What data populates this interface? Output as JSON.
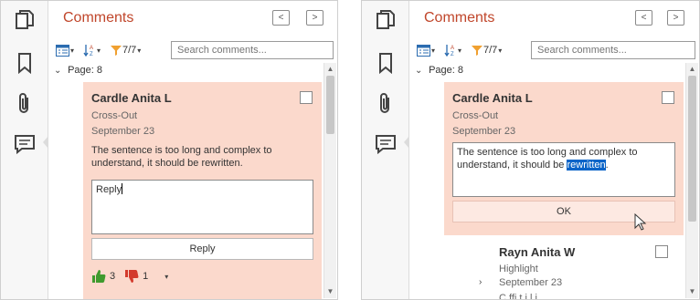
{
  "panel": {
    "title": "Comments",
    "prev_label": "<",
    "next_label": ">",
    "filter_count": "7/7",
    "search_placeholder": "Search comments...",
    "page_group": "Page: 8"
  },
  "left_card": {
    "author": "Cardle Anita L",
    "type": "Cross-Out",
    "date": "September 23",
    "text": "The sentence is too long and complex to understand, it should be rewritten.",
    "reply_value": "Reply",
    "reply_button": "Reply",
    "likes": "3",
    "dislikes": "1"
  },
  "right_card": {
    "author": "Cardle Anita L",
    "type": "Cross-Out",
    "date": "September 23",
    "text_before": "The sentence is too long and complex to understand, it should be ",
    "text_selected": "rewritten",
    "text_after": ".",
    "ok_button": "OK"
  },
  "second_card": {
    "author": "Rayn Anita W",
    "type": "Highlight",
    "date": "September 23",
    "cut_text": "C ffi t                    i l            i     "
  },
  "colors": {
    "accent": "#c0462b",
    "card_bg": "#fbd9cc",
    "selection": "#0a64c8",
    "like": "#3f9a2e",
    "dislike": "#d33a2c"
  }
}
